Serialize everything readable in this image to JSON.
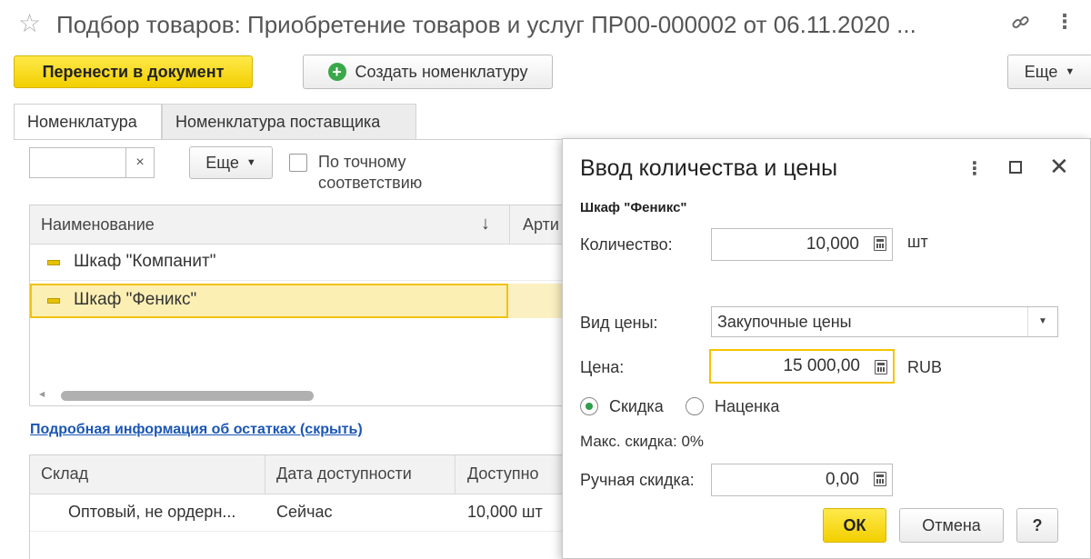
{
  "header": {
    "title": "Подбор товаров: Приобретение товаров и услуг ПР00-000002 от 06.11.2020 ...",
    "star_icon": "star-icon",
    "link_icon": "link-icon",
    "menu_icon": "more-vertical-icon"
  },
  "toolbar": {
    "transfer_label": "Перенести в документ",
    "create_label": "Создать номенклатуру",
    "more_label": "Еще"
  },
  "tabs": [
    {
      "label": "Номенклатура",
      "active": true
    },
    {
      "label": "Номенклатура поставщика",
      "active": false
    }
  ],
  "filter": {
    "search_value": "",
    "clear_symbol": "×",
    "more_label": "Еще",
    "exact_match_label": "По точному соответствию",
    "exact_match_line1": "По точному",
    "exact_match_line2": "соответствию",
    "exact_match_checked": false
  },
  "items_table": {
    "col_name": "Наименование",
    "sort_arrow": "↓",
    "col_article": "Арти",
    "rows": [
      {
        "name": "Шкаф \"Компанит\"",
        "selected": false
      },
      {
        "name": "Шкаф \"Феникс\"",
        "selected": true
      }
    ]
  },
  "stock_link": "Подробная информация об остатках (скрыть)",
  "stock_table": {
    "col_warehouse": "Склад",
    "col_date": "Дата доступности",
    "col_available": "Доступно",
    "rows": [
      {
        "warehouse": "Оптовый, не ордерн...",
        "date": "Сейчас",
        "available": "10,000 шт"
      }
    ]
  },
  "dialog": {
    "title": "Ввод количества и цены",
    "item_name": "Шкаф \"Феникс\"",
    "qty_label": "Количество:",
    "qty_value": "10,000",
    "qty_unit": "шт",
    "price_type_label": "Вид цены:",
    "price_type_value": "Закупочные цены",
    "price_label": "Цена:",
    "price_value": "15 000,00",
    "currency": "RUB",
    "discount_label": "Скидка",
    "markup_label": "Наценка",
    "discount_selected": true,
    "max_discount": "Макс. скидка: 0%",
    "manual_discount_label": "Ручная скидка:",
    "manual_discount_value": "0,00",
    "ok_label": "ОК",
    "cancel_label": "Отмена",
    "help_label": "?",
    "accent_color": "#f5d400"
  }
}
